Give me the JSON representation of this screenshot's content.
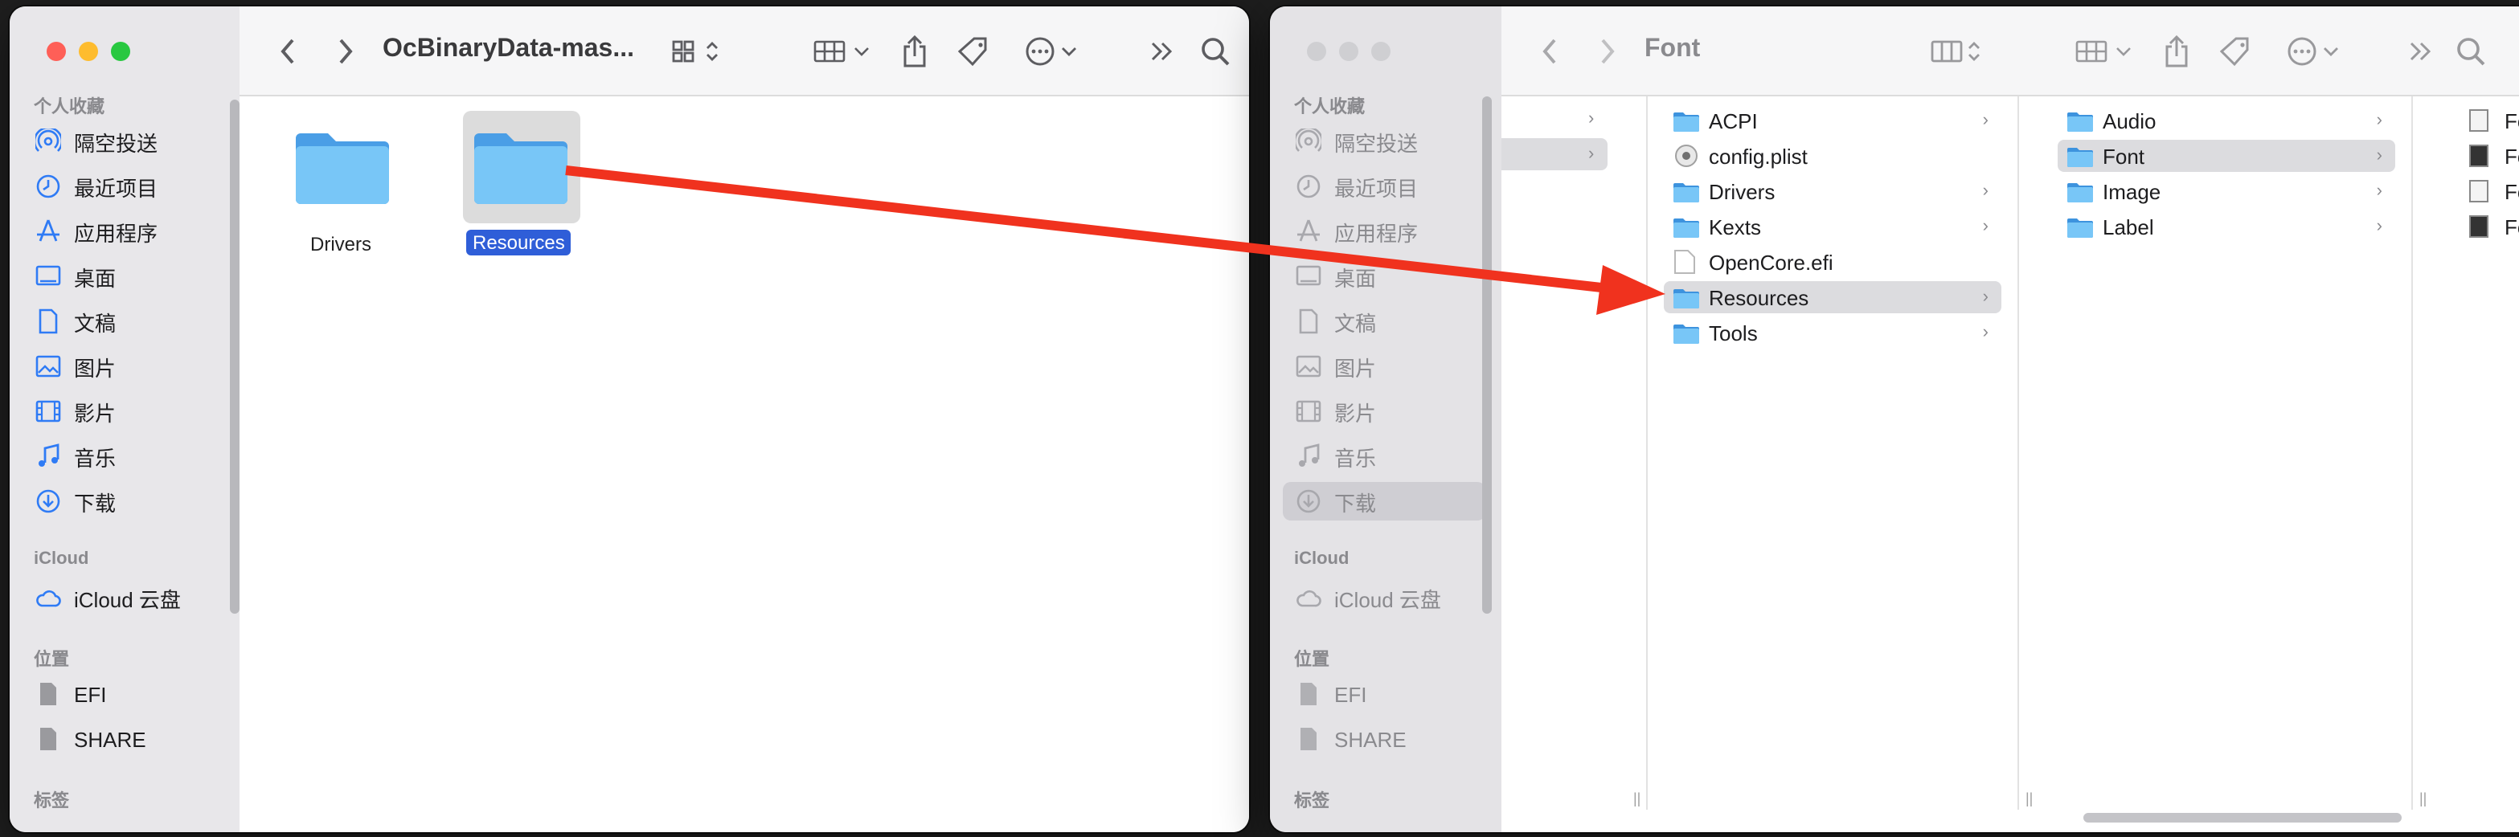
{
  "left_window": {
    "title": "OcBinaryData-mas...",
    "sidebar": {
      "favorites_header": "个人收藏",
      "favorites": [
        {
          "label": "隔空投送",
          "icon": "airdrop-icon"
        },
        {
          "label": "最近项目",
          "icon": "clock-icon"
        },
        {
          "label": "应用程序",
          "icon": "applications-icon"
        },
        {
          "label": "桌面",
          "icon": "desktop-icon"
        },
        {
          "label": "文稿",
          "icon": "document-icon"
        },
        {
          "label": "图片",
          "icon": "photo-icon"
        },
        {
          "label": "影片",
          "icon": "film-icon"
        },
        {
          "label": "音乐",
          "icon": "music-icon"
        },
        {
          "label": "下载",
          "icon": "download-icon"
        }
      ],
      "icloud_header": "iCloud",
      "icloud_drive": "iCloud 云盘",
      "locations_header": "位置",
      "locations": [
        "EFI",
        "SHARE"
      ],
      "tags_header": "标签"
    },
    "items": [
      {
        "label": "Drivers",
        "selected": false
      },
      {
        "label": "Resources",
        "selected": true
      }
    ]
  },
  "right_window": {
    "title": "Font",
    "sidebar": {
      "favorites_header": "个人收藏",
      "favorites": [
        {
          "label": "隔空投送",
          "icon": "airdrop-icon"
        },
        {
          "label": "最近项目",
          "icon": "clock-icon"
        },
        {
          "label": "应用程序",
          "icon": "applications-icon"
        },
        {
          "label": "桌面",
          "icon": "desktop-icon"
        },
        {
          "label": "文稿",
          "icon": "document-icon"
        },
        {
          "label": "图片",
          "icon": "photo-icon"
        },
        {
          "label": "影片",
          "icon": "film-icon"
        },
        {
          "label": "音乐",
          "icon": "music-icon"
        },
        {
          "label": "下载",
          "icon": "download-icon"
        }
      ],
      "icloud_header": "iCloud",
      "icloud_drive": "iCloud 云盘",
      "locations_header": "位置",
      "locations": [
        "EFI",
        "SHARE"
      ],
      "tags_header": "标签"
    },
    "column2": [
      {
        "label": "ACPI",
        "type": "folder",
        "chevron": true
      },
      {
        "label": "config.plist",
        "type": "plist",
        "chevron": false
      },
      {
        "label": "Drivers",
        "type": "folder",
        "chevron": true
      },
      {
        "label": "Kexts",
        "type": "folder",
        "chevron": true
      },
      {
        "label": "OpenCore.efi",
        "type": "file",
        "chevron": false
      },
      {
        "label": "Resources",
        "type": "folder",
        "chevron": true,
        "selected": true
      },
      {
        "label": "Tools",
        "type": "folder",
        "chevron": true
      }
    ],
    "column3": [
      {
        "label": "Audio",
        "type": "folder",
        "chevron": true
      },
      {
        "label": "Font",
        "type": "folder",
        "chevron": true,
        "selected": true
      },
      {
        "label": "Image",
        "type": "folder",
        "chevron": true
      },
      {
        "label": "Label",
        "type": "folder",
        "chevron": true
      }
    ],
    "column4": [
      "Fo",
      "Fo",
      "Fo",
      "Fo"
    ]
  },
  "colors": {
    "folder_blue": "#6fc0f4",
    "selection_blue": "#2f5ed8",
    "arrow_red": "#f0321e"
  }
}
